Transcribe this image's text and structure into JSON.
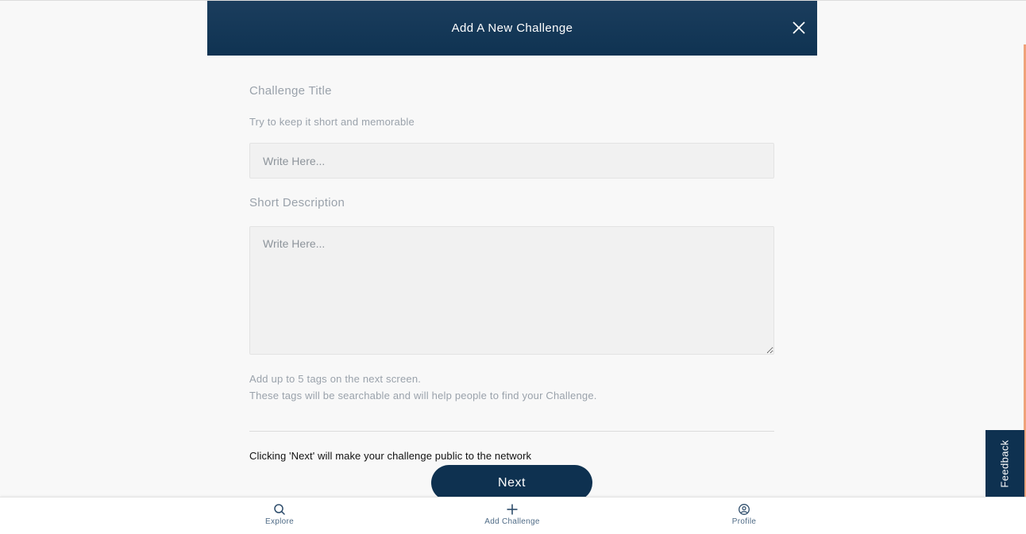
{
  "modal": {
    "title": "Add A New Challenge",
    "close_icon": "close-icon"
  },
  "form": {
    "title_label": "Challenge Title",
    "title_hint": "Try to keep it short and memorable",
    "title_placeholder": "Write Here...",
    "title_value": "",
    "description_label": "Short Description",
    "description_placeholder": "Write Here...",
    "description_value": "",
    "tags_note_line1": "Add up to 5 tags on the next screen.",
    "tags_note_line2": "These tags will be searchable and will help people to find your Challenge.",
    "public_notice": "Clicking 'Next' will make your challenge public to the network",
    "next_label": "Next"
  },
  "bottom_nav": {
    "items": [
      {
        "label": "Explore",
        "icon": "search-icon"
      },
      {
        "label": "Add Challenge",
        "icon": "plus-icon"
      },
      {
        "label": "Profile",
        "icon": "user-circle-icon"
      }
    ]
  },
  "feedback": {
    "label": "Feedback"
  },
  "colors": {
    "header": "#0f3352",
    "primary_button": "#0e3150",
    "label_text": "#9aa2ab",
    "nav_label": "#4f6b86",
    "scroll_accent": "#f0a27a"
  }
}
